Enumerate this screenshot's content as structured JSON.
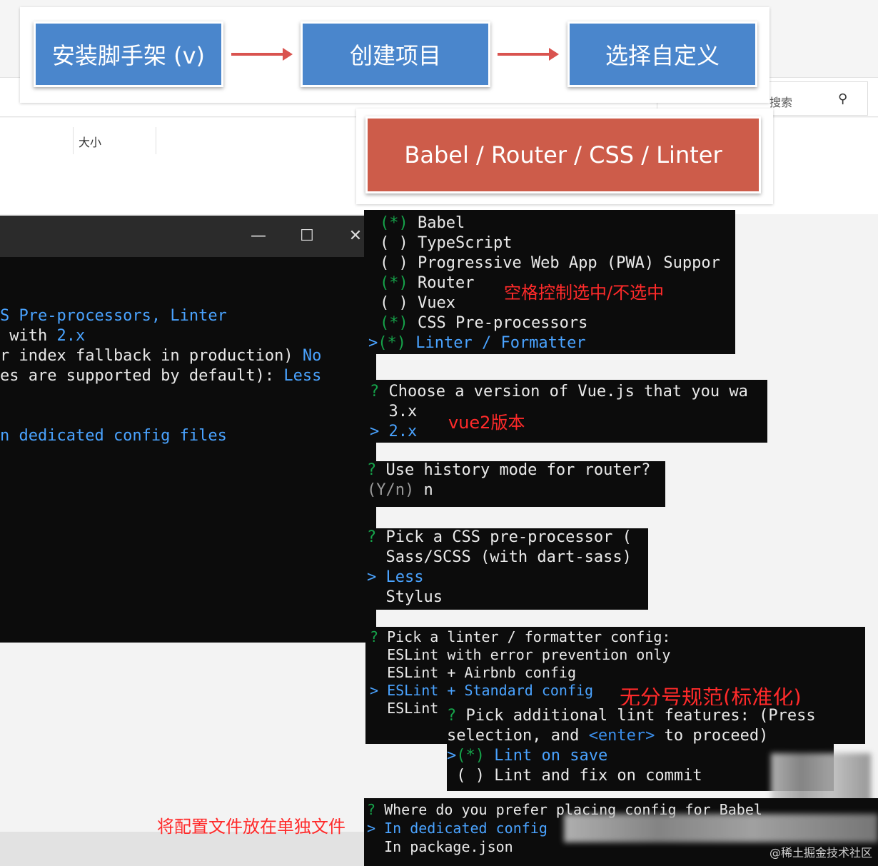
{
  "flow": {
    "step1": "安装脚手架 (v)",
    "step2": "创建项目",
    "step3": "选择自定义",
    "features": "Babel / Router / CSS / Linter"
  },
  "explorer": {
    "size_col": "大小",
    "search_placeholder": "搜索",
    "search_icon": "search-icon"
  },
  "window_controls": {
    "minimize": "—",
    "maximize": "☐",
    "close": "✕"
  },
  "main_terminal": {
    "line1": "S Pre-processors, Linter",
    "line2_prefix": " with ",
    "line2_value": "2.x",
    "line3_prefix": "r index fallback in production) ",
    "line3_value": "No",
    "line4_prefix": "es are supported by default): ",
    "line4_value": "Less",
    "line5": "n dedicated config files"
  },
  "features_select": {
    "items": [
      {
        "mark": "(*)",
        "label": "Babel"
      },
      {
        "mark": "( )",
        "label": "TypeScript"
      },
      {
        "mark": "( )",
        "label": "Progressive Web App (PWA) Suppor"
      },
      {
        "mark": "(*)",
        "label": "Router"
      },
      {
        "mark": "( )",
        "label": "Vuex"
      },
      {
        "mark": "(*)",
        "label": "CSS Pre-processors"
      },
      {
        "mark": "(*)",
        "label": "Linter / Formatter"
      }
    ],
    "cursor": ">",
    "note": "空格控制选中/不选中"
  },
  "vue_version": {
    "question": "Choose a version of Vue.js that you wa",
    "options": [
      "3.x",
      "2.x"
    ],
    "note": "vue2版本"
  },
  "history_mode": {
    "question": "Use history mode for router?",
    "hint": "(Y/n)",
    "answer": "n"
  },
  "css_preprocessor": {
    "question": "Pick a CSS pre-processor (",
    "options": [
      "Sass/SCSS (with dart-sass)",
      "Less",
      "Stylus"
    ]
  },
  "linter_config": {
    "question": "Pick a linter / formatter config:",
    "options": [
      "ESLint with error prevention only",
      "ESLint + Airbnb config",
      "ESLint + Standard config",
      "ESLint"
    ],
    "note": "无分号规范(标准化)"
  },
  "lint_features": {
    "question_line1": "Pick additional lint features: (Press",
    "question_line2_a": "selection, and ",
    "question_line2_b": "<enter>",
    "question_line2_c": " to proceed)",
    "options": [
      {
        "mark": "(*)",
        "label": "Lint on save"
      },
      {
        "mark": "( )",
        "label": "Lint and fix on commit"
      }
    ]
  },
  "config_placement": {
    "question": "Where do you prefer placing config for Babel",
    "options": [
      "In dedicated config",
      "In package.json"
    ],
    "note": "将配置文件放在单独文件"
  },
  "prompt_mark": "?",
  "watermark": "@稀土掘金技术社区"
}
